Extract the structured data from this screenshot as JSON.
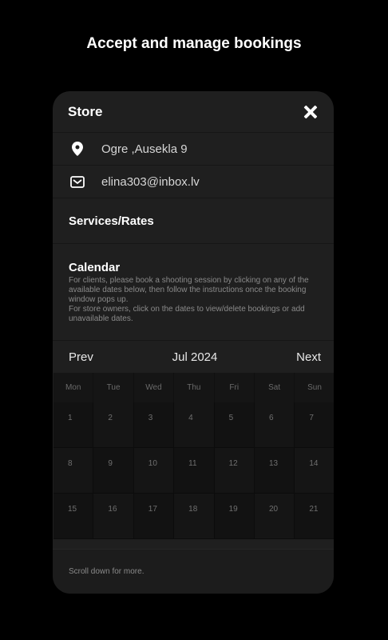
{
  "headline": "Accept and manage bookings",
  "card": {
    "title": "Store",
    "address": "Ogre ,Ausekla 9",
    "email": "elina303@inbox.lv",
    "services_title": "Services/Rates",
    "calendar_title": "Calendar",
    "calendar_description": "For clients, please book a shooting session by clicking on any of the\navailable dates below, then follow the instructions once the booking\nwindow pops up.\nFor store owners, click on the dates to view/delete bookings or add\nunavailable dates.",
    "nav": {
      "prev": "Prev",
      "month": "Jul 2024",
      "next": "Next"
    },
    "weekdays": [
      "Mon",
      "Tue",
      "Wed",
      "Thu",
      "Fri",
      "Sat",
      "Sun"
    ],
    "weeks": [
      [
        "1",
        "2",
        "3",
        "4",
        "5",
        "6",
        "7"
      ],
      [
        "8",
        "9",
        "10",
        "11",
        "12",
        "13",
        "14"
      ],
      [
        "15",
        "16",
        "17",
        "18",
        "19",
        "20",
        "21"
      ]
    ],
    "footer": "Scroll down for more."
  },
  "icons": {
    "close": "close-icon",
    "location": "location-pin-icon",
    "email": "envelope-icon"
  },
  "colors": {
    "background": "#000000",
    "card": "#1f1f1f",
    "accent": "#ffffff"
  }
}
